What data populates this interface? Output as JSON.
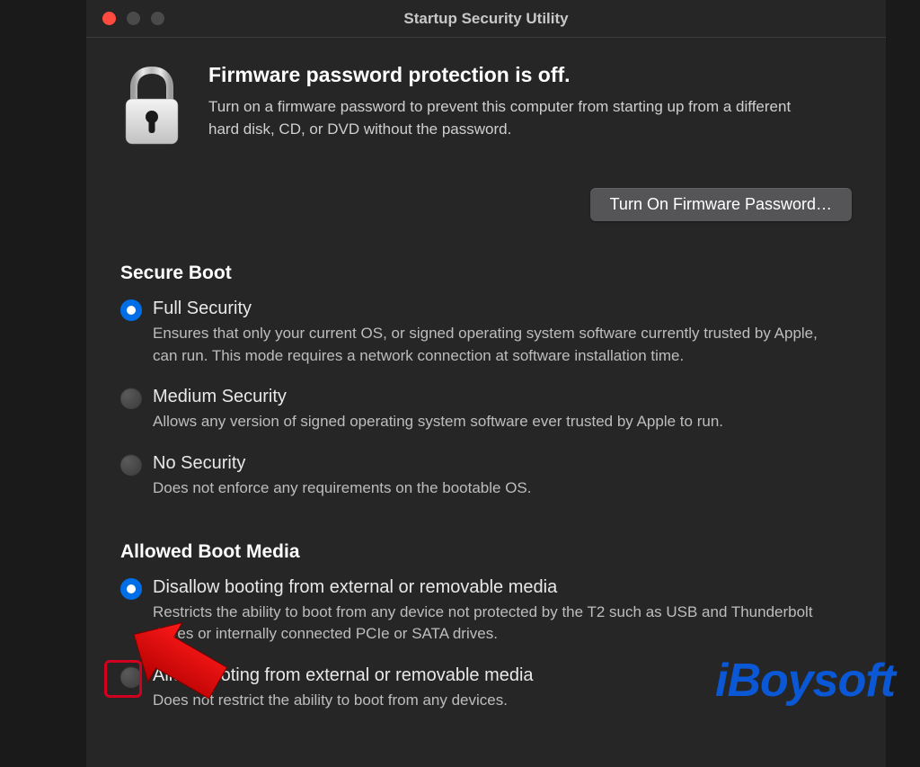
{
  "window": {
    "title": "Startup Security Utility"
  },
  "firmware": {
    "heading": "Firmware password protection is off.",
    "description": "Turn on a firmware password to prevent this computer from starting up from a different hard disk, CD, or DVD without the password.",
    "button_label": "Turn On Firmware Password…"
  },
  "secure_boot": {
    "heading": "Secure Boot",
    "options": [
      {
        "label": "Full Security",
        "description": "Ensures that only your current OS, or signed operating system software currently trusted by Apple, can run. This mode requires a network connection at software installation time.",
        "selected": true
      },
      {
        "label": "Medium Security",
        "description": "Allows any version of signed operating system software ever trusted by Apple to run.",
        "selected": false
      },
      {
        "label": "No Security",
        "description": "Does not enforce any requirements on the bootable OS.",
        "selected": false
      }
    ]
  },
  "allowed_boot_media": {
    "heading": "Allowed Boot Media",
    "options": [
      {
        "label": "Disallow booting from external or removable media",
        "description": "Restricts the ability to boot from any device not protected by the T2 such as USB and Thunderbolt drives or internally connected PCIe or SATA drives.",
        "selected": true
      },
      {
        "label": "Allow booting from external or removable media",
        "description": "Does not restrict the ability to boot from any devices.",
        "selected": false
      }
    ]
  },
  "watermark": "iBoysoft"
}
